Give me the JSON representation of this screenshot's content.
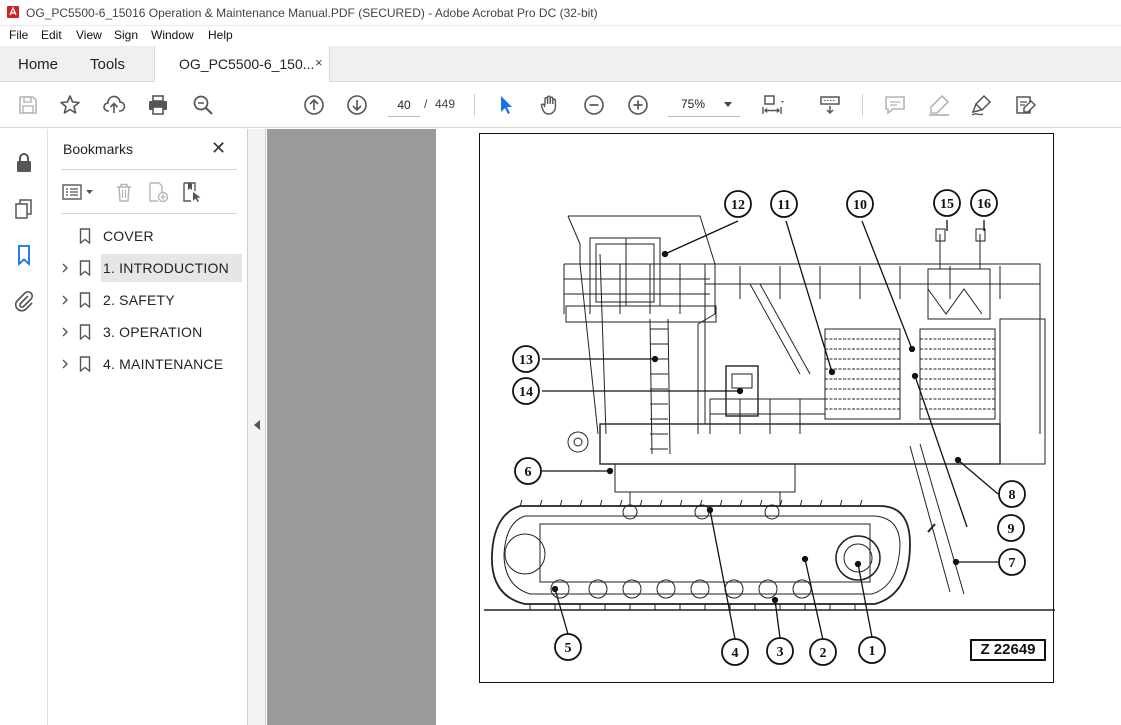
{
  "window": {
    "title": "OG_PC5500-6_15016 Operation & Maintenance Manual.PDF (SECURED) - Adobe Acrobat Pro DC (32-bit)"
  },
  "menu": [
    "File",
    "Edit",
    "View",
    "Sign",
    "Window",
    "Help"
  ],
  "tabs": {
    "home": "Home",
    "tools": "Tools",
    "document": "OG_PC5500-6_150...",
    "close": "×"
  },
  "toolbar": {
    "current_page": "40",
    "page_separator": "/",
    "total_pages": "449",
    "zoom": "75%"
  },
  "icons": {
    "save": "save-icon",
    "bookmark_star": "star-icon",
    "upload": "cloud-upload-icon",
    "print": "print-icon",
    "find": "search-zoom-icon",
    "prev_page": "arrow-up-circle-icon",
    "next_page": "arrow-down-circle-icon",
    "select": "pointer-icon",
    "hand": "hand-icon",
    "zoom_out": "zoom-out-icon",
    "zoom_in": "zoom-in-icon"
  },
  "bookmarks": {
    "title": "Bookmarks",
    "close": "✕",
    "items": [
      {
        "label": "COVER",
        "expandable": false
      },
      {
        "label": "1.  INTRODUCTION",
        "expandable": true,
        "selected": true
      },
      {
        "label": "2.  SAFETY",
        "expandable": true
      },
      {
        "label": "3.  OPERATION",
        "expandable": true
      },
      {
        "label": "4.  MAINTENANCE",
        "expandable": true
      }
    ]
  },
  "figure": {
    "reference": "Z 22649",
    "callouts": [
      "1",
      "2",
      "3",
      "4",
      "5",
      "6",
      "7",
      "8",
      "9",
      "10",
      "11",
      "12",
      "13",
      "14",
      "15",
      "16"
    ]
  }
}
